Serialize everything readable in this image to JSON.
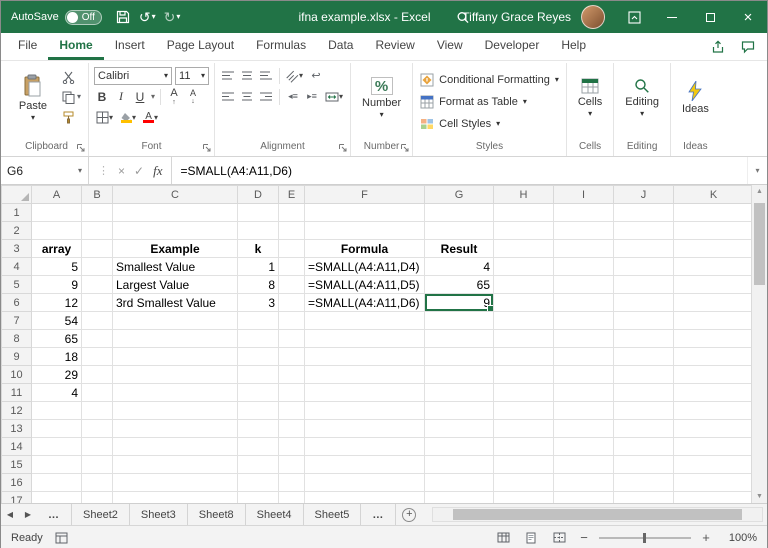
{
  "titlebar": {
    "autosave_label": "AutoSave",
    "autosave_state": "Off",
    "title": "ifna example.xlsx - Excel",
    "user_name": "Tiffany Grace Reyes"
  },
  "ribbon": {
    "tabs": [
      "File",
      "Home",
      "Insert",
      "Page Layout",
      "Formulas",
      "Data",
      "Review",
      "View",
      "Developer",
      "Help"
    ],
    "active_tab": "Home",
    "clipboard": {
      "label": "Clipboard",
      "paste": "Paste"
    },
    "font": {
      "label": "Font",
      "font_name": "Calibri",
      "font_size": "11",
      "bold": "B",
      "italic": "I",
      "underline": "U"
    },
    "alignment": {
      "label": "Alignment"
    },
    "number": {
      "label": "Number",
      "button": "Number",
      "icon": "%"
    },
    "styles": {
      "label": "Styles",
      "items": [
        "Conditional Formatting",
        "Format as Table",
        "Cell Styles"
      ]
    },
    "cells": {
      "label": "Cells",
      "button": "Cells"
    },
    "editing": {
      "label": "Editing",
      "button": "Editing"
    },
    "ideas": {
      "label": "Ideas",
      "button": "Ideas"
    }
  },
  "formula_bar": {
    "name_box": "G6",
    "fx_label": "fx",
    "formula": "=SMALL(A4:A11,D6)"
  },
  "grid": {
    "columns": [
      "A",
      "B",
      "C",
      "D",
      "E",
      "F",
      "G",
      "H",
      "I",
      "J",
      "K"
    ],
    "row_labels": [
      "1",
      "2",
      "3",
      "4",
      "5",
      "6",
      "7",
      "8",
      "9",
      "10",
      "11",
      "12",
      "13",
      "14",
      "15",
      "16",
      "17"
    ],
    "selected_cell": "G6",
    "selected_column": "G",
    "selected_row": "6",
    "header_cells": [
      "A3",
      "C3",
      "D3",
      "F3",
      "G3"
    ],
    "bordered_cells": [
      "G4",
      "G5",
      "G6"
    ],
    "header_fill_color": "#1F4E79",
    "selection_color": "#217346",
    "cells": {
      "A3": "array",
      "A4": "5",
      "A5": "9",
      "A6": "12",
      "A7": "54",
      "A8": "65",
      "A9": "18",
      "A10": "29",
      "A11": "4",
      "C3": "Example",
      "C4": "Smallest Value",
      "C5": "Largest Value",
      "C6": "3rd Smallest Value",
      "D3": "k",
      "D4": "1",
      "D5": "8",
      "D6": "3",
      "F3": "Formula",
      "F4": "=SMALL(A4:A11,D4)",
      "F5": "=SMALL(A4:A11,D5)",
      "F6": "=SMALL(A4:A11,D6)",
      "G3": "Result",
      "G4": "4",
      "G5": "65",
      "G6": "9"
    }
  },
  "sheet_tabs": {
    "tabs": [
      "Sheet2",
      "Sheet3",
      "Sheet8",
      "Sheet4",
      "Sheet5"
    ],
    "overflow": "…"
  },
  "status_bar": {
    "mode": "Ready",
    "zoom_level": "100%"
  }
}
